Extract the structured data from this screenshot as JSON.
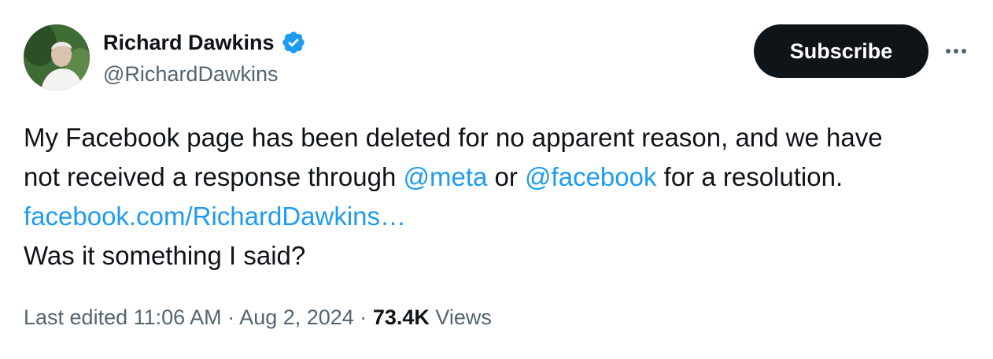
{
  "author": {
    "display_name": "Richard Dawkins",
    "handle": "@RichardDawkins",
    "verified_icon": "verified-badge-icon",
    "verified_color": "#1d9bf0"
  },
  "actions": {
    "subscribe_label": "Subscribe",
    "more_icon": "more-options-icon"
  },
  "tweet": {
    "line1": "My Facebook page has been deleted for no apparent reason, and we have",
    "line2_prefix": "not received a response through ",
    "mention1": "@meta",
    "line2_mid": " or ",
    "mention2": "@facebook",
    "line2_suffix": " for a resolution.",
    "link": "facebook.com/RichardDawkins…",
    "line4": "Was it something I said?"
  },
  "footer": {
    "edited_label": "Last edited 11:06 AM · Aug 2, 2024 · ",
    "views_count": "73.4K",
    "views_label": " Views"
  },
  "colors": {
    "link": "#1d9bf0",
    "text": "#0f1419",
    "secondary": "#536471"
  }
}
